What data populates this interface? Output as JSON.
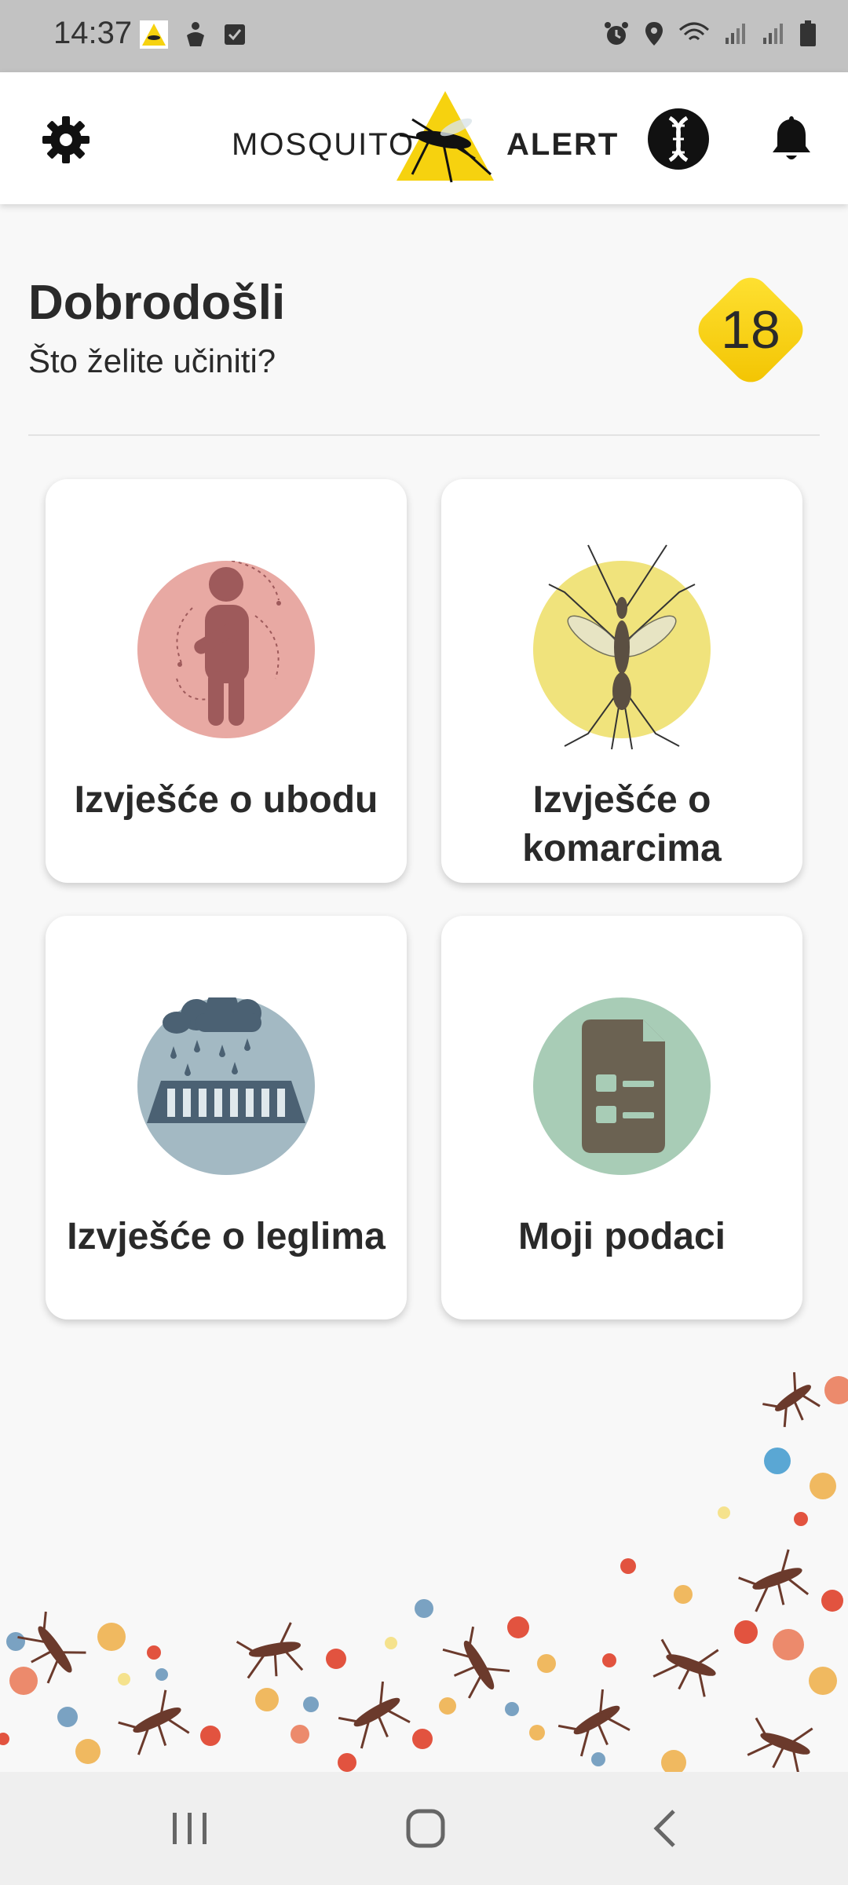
{
  "status_bar": {
    "time": "14:37"
  },
  "app_bar": {
    "logo_word_1": "MOSQUITO",
    "logo_word_2": "ALERT"
  },
  "welcome": {
    "title": "Dobrodošli",
    "subtitle": "Što želite učiniti?",
    "score": "18"
  },
  "cards": [
    {
      "label": "Izvješće o ubodu",
      "icon": "bite-icon"
    },
    {
      "label": "Izvješće o komarcima",
      "icon": "mosquito-icon"
    },
    {
      "label": "Izvješće o leglima",
      "icon": "breeding-site-icon"
    },
    {
      "label": "Moji podaci",
      "icon": "document-icon"
    }
  ],
  "colors": {
    "accent_yellow": "#f6d20f",
    "bite_circle": "#e8a9a3",
    "mosquito_circle": "#f0e37c",
    "site_circle": "#a3b9c3",
    "data_circle": "#a8ccb6"
  }
}
